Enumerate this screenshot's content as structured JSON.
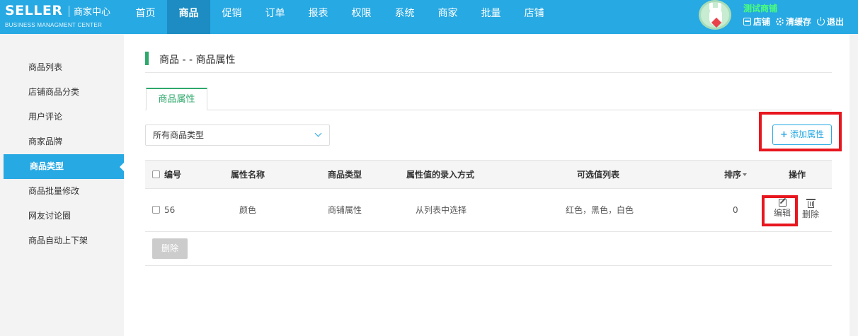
{
  "header": {
    "logo": "SELLER",
    "logo_sub": "商家中心",
    "logo_en": "BUSINESS MANAGMENT CENTER",
    "nav": [
      "首页",
      "商品",
      "促销",
      "订单",
      "报表",
      "权限",
      "系统",
      "商家",
      "批量",
      "店铺"
    ],
    "active_nav": "商品",
    "shop_name": "测试商铺",
    "links": {
      "store": "店铺",
      "clear_cache": "清缓存",
      "logout": "退出"
    }
  },
  "sidebar": {
    "items": [
      "商品列表",
      "店铺商品分类",
      "用户评论",
      "商家品牌",
      "商品类型",
      "商品批量修改",
      "网友讨论圈",
      "商品自动上下架"
    ],
    "active": "商品类型"
  },
  "main": {
    "title": "商品 - - 商品属性",
    "tab": "商品属性",
    "select_value": "所有商品类型",
    "add_button": "添加属性",
    "table": {
      "headers": {
        "id": "编号",
        "name": "属性名称",
        "type": "商品类型",
        "input_method": "属性值的录入方式",
        "options": "可选值列表",
        "sort": "排序",
        "actions": "操作"
      },
      "rows": [
        {
          "id": "56",
          "name": "颜色",
          "type": "商铺属性",
          "input_method": "从列表中选择",
          "options": "红色，黑色，白色",
          "sort": "0",
          "edit": "编辑",
          "delete": "删除"
        }
      ]
    },
    "bulk_delete": "删除"
  },
  "colors": {
    "header_bg": "#27a9e3",
    "nav_active_bg": "#1c8cc2",
    "accent_green": "#2ea86b",
    "shop_name": "#4aff7a",
    "highlight_red": "#e8161e"
  }
}
